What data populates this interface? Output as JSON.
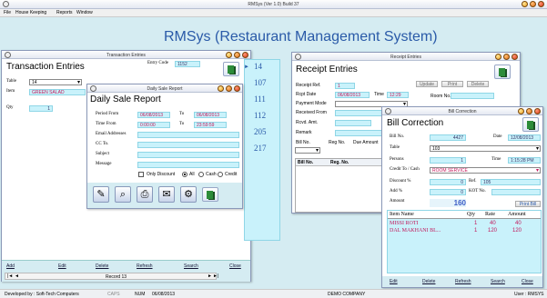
{
  "app": {
    "title": "RMSys (Ver 1.0) Build 37",
    "banner": "RMSys (Restaurant Management System)",
    "menu": [
      "File",
      "House Keeping",
      "Reports",
      "Window"
    ]
  },
  "tx": {
    "title": "Transaction Entries",
    "window_title": "Transaction Entries",
    "entry_code_label": "Entry Code",
    "entry_code": "1152",
    "table_label": "Table",
    "table_value": "14",
    "item_label": "Item",
    "item_value": "GREEN SALAD",
    "qty_label": "Qty",
    "qty_value": "1",
    "table_list": [
      "14",
      "107",
      "111",
      "112",
      "205",
      "217"
    ],
    "buttons": {
      "add": "Add",
      "edit": "Edit",
      "delete": "Delete",
      "refresh": "Refresh",
      "search": "Search",
      "close": "Close"
    },
    "record": "Record 13"
  },
  "dsr": {
    "window_title": "Daily Sale Report",
    "title": "Daily Sale Report",
    "period_from_label": "Period From",
    "period_from": "06/08/2013",
    "period_to_label": "To",
    "period_to": "06/08/2013",
    "time_from_label": "Time From",
    "time_from": "0:00:00",
    "time_to_label": "To",
    "time_to": "23:59:59",
    "email_label": "Email Addresses",
    "cc_label": "CC To.",
    "subject_label": "Subject",
    "message_label": "Message",
    "only_discount": "Only Discount",
    "opt_all": "All",
    "opt_cash": "Cash",
    "opt_credit": "Credit"
  },
  "receipt": {
    "window_title": "Receipt Entries",
    "title": "Receipt Entries",
    "ref_label": "Receipt Ref.",
    "ref_value": "1",
    "date_label": "Rcpt Date",
    "date_value": "06/08/2013",
    "time_label": "Time",
    "time_value": "12:29",
    "mode_label": "Payment Mode",
    "recv_from_label": "Received From",
    "rcvd_amt_label": "Rcvd. Amt.",
    "remark_label": "Remark",
    "bill_no_label": "Bill No.",
    "reg_no_label": "Reg No.",
    "due_amt_label": "Due Amount",
    "room_no_label": "Room No.",
    "update": "Update",
    "print": "Print",
    "delete": "Delete",
    "col_bill": "Bill No.",
    "col_reg": "Reg. No."
  },
  "bc": {
    "window_title": "Bill Correction",
    "title": "Bill Correction",
    "bill_no_label": "Bill No.",
    "bill_no": "4427",
    "date_label": "Date",
    "date": "12/08/2013",
    "table_label": "Table",
    "table": "103",
    "persons_label": "Persons",
    "persons": "1",
    "time_label": "Time",
    "time": "1:15:28 PM",
    "credit_label": "Credit To / Cash",
    "credit": "ROOM SERVICE",
    "discount_label": "Discount %",
    "discount": "0",
    "ref_label": "Ref.",
    "ref": "105",
    "add_label": "Add %",
    "add": "0",
    "kot_label": "KOT No.",
    "amount_label": "Amount",
    "amount": "160",
    "print_bill": "Print Bill",
    "columns": [
      "Item Name",
      "Qty",
      "Rate",
      "Amount"
    ],
    "rows": [
      {
        "name": "MISSI ROTI",
        "qty": "1",
        "rate": "40",
        "amount": "40"
      },
      {
        "name": "DAL MAKHANI BL...",
        "qty": "1",
        "rate": "120",
        "amount": "120"
      }
    ],
    "buttons": {
      "edit": "Edit",
      "delete": "Delete",
      "refresh": "Refresh",
      "search": "Search",
      "close": "Close"
    }
  },
  "status": {
    "developer": "Developed by : Soft-Tech Computers",
    "caps": "CAPS",
    "num": "NUM",
    "date": "06/08/2013",
    "company": "DEMO COMPANY",
    "user": "User : RMSYS"
  }
}
